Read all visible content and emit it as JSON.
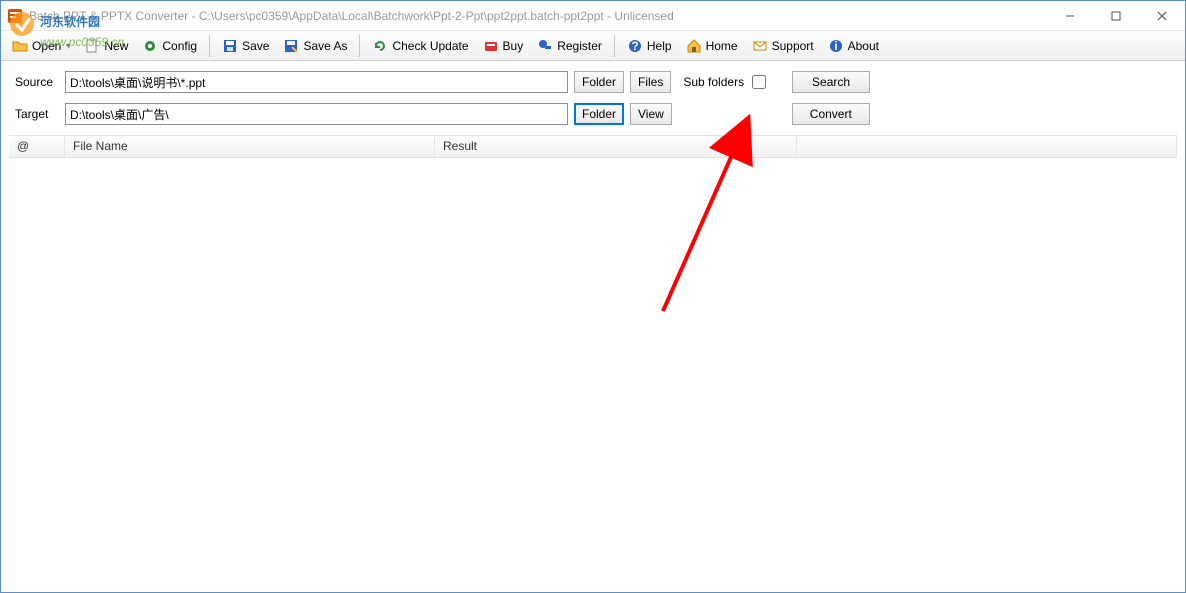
{
  "title": "Batch PPT & PPTX Converter - C:\\Users\\pc0359\\AppData\\Local\\Batchwork\\Ppt-2-Ppt\\ppt2ppt.batch-ppt2ppt - Unlicensed",
  "toolbar": {
    "open": "Open",
    "new": "New",
    "config": "Config",
    "save": "Save",
    "save_as": "Save As",
    "check_update": "Check Update",
    "buy": "Buy",
    "register": "Register",
    "help": "Help",
    "home": "Home",
    "support": "Support",
    "about": "About"
  },
  "form": {
    "source_label": "Source",
    "source_value": "D:\\tools\\桌面\\说明书\\*.ppt",
    "target_label": "Target",
    "target_value": "D:\\tools\\桌面\\广告\\",
    "folder_btn": "Folder",
    "files_btn": "Files",
    "view_btn": "View",
    "subfolders_label": "Sub folders",
    "subfolders_checked": false,
    "search_btn": "Search",
    "convert_btn": "Convert"
  },
  "table": {
    "col_at": "@",
    "col_file": "File Name",
    "col_result": "Result"
  },
  "watermark": {
    "line1": "河东软件园",
    "line2": "www.pc0359.cn"
  }
}
